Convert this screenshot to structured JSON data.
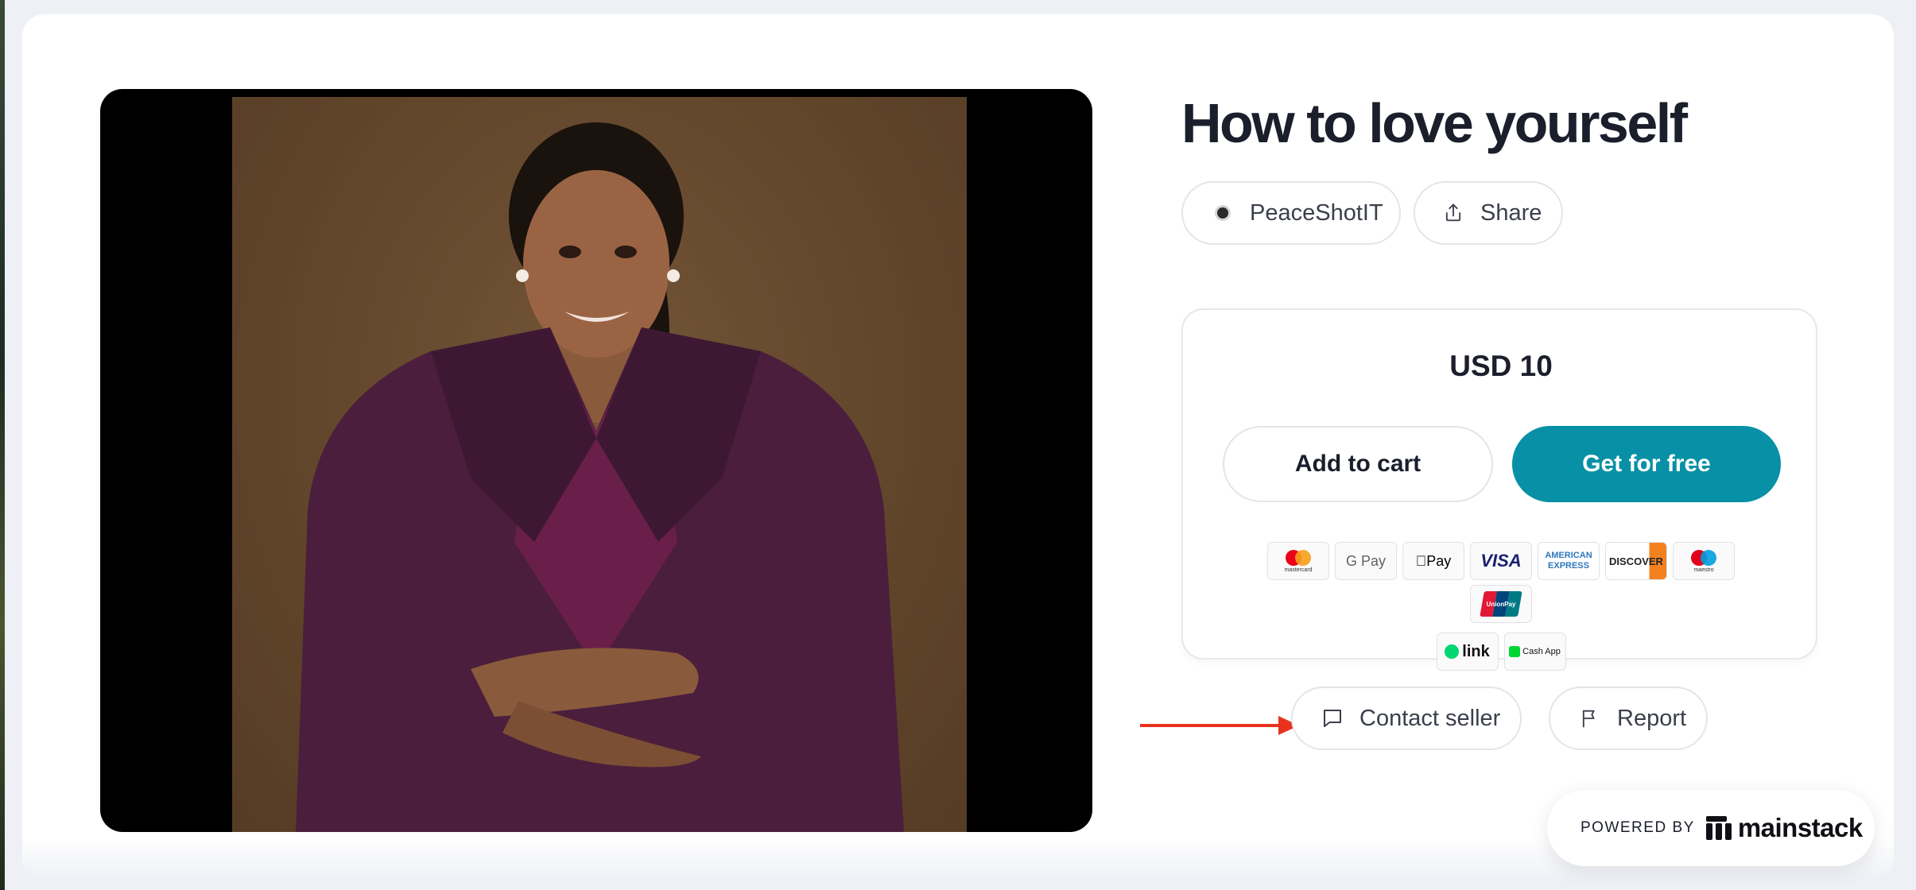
{
  "product": {
    "title": "How to love yourself",
    "seller": "PeaceShotIT",
    "share_label": "Share"
  },
  "pricing": {
    "price": "USD 10",
    "add_to_cart_label": "Add to cart",
    "get_free_label": "Get for free",
    "accent_color": "#0790a6"
  },
  "payment_methods": {
    "mastercard": "mastercard",
    "gpay": "G Pay",
    "applepay": "Pay",
    "visa": "VISA",
    "amex_line1": "AMERICAN",
    "amex_line2": "EXPRESS",
    "discover": "DISCOVER",
    "maestro": "maestro",
    "unionpay": "UnionPay",
    "link": "link",
    "cashapp": "Cash App"
  },
  "actions": {
    "contact_seller_label": "Contact seller",
    "report_label": "Report"
  },
  "footer": {
    "powered_by": "POWERED BY",
    "brand": "mainstack"
  },
  "annotation": {
    "arrow_color": "#e8321e"
  }
}
